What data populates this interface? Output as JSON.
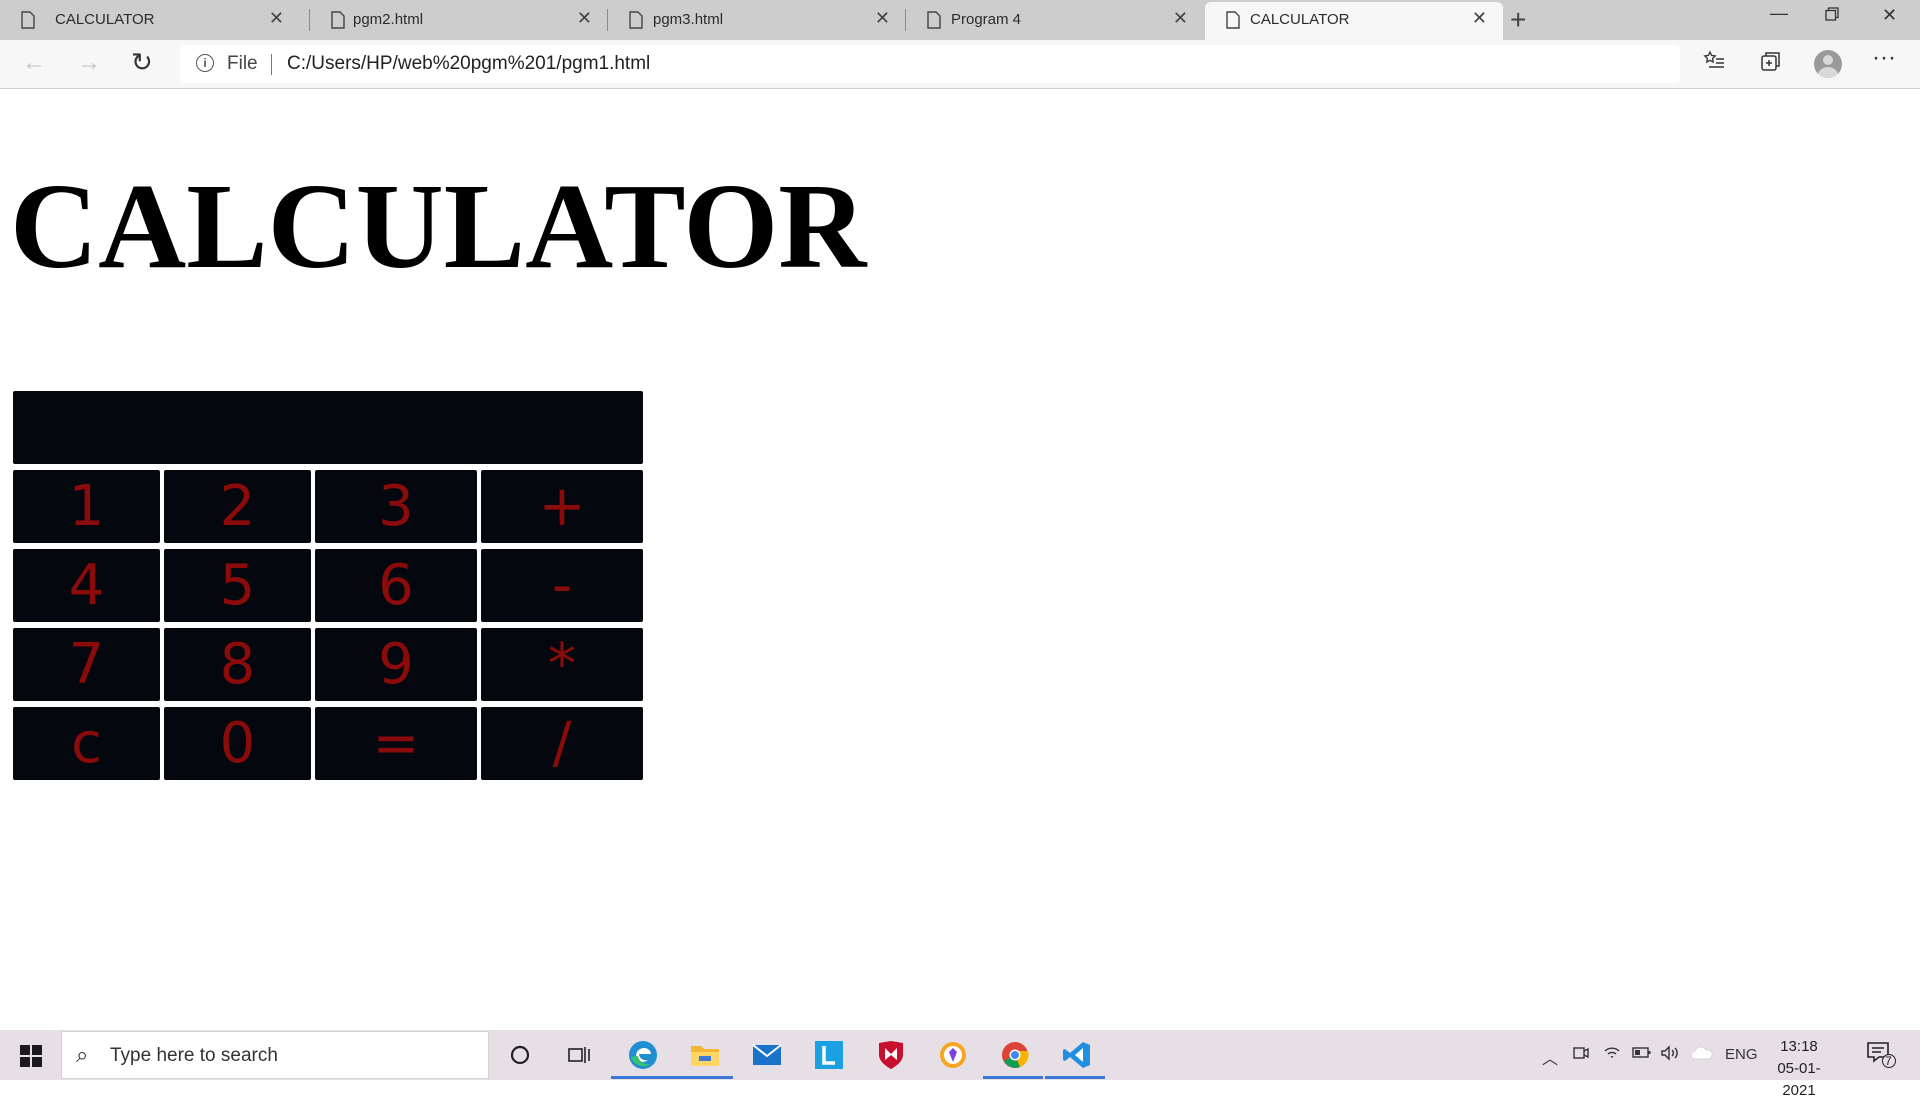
{
  "browser": {
    "tabs": [
      {
        "title": "CALCULATOR",
        "active": false
      },
      {
        "title": "pgm2.html",
        "active": false
      },
      {
        "title": "pgm3.html",
        "active": false
      },
      {
        "title": "Program 4",
        "active": false
      },
      {
        "title": "CALCULATOR",
        "active": true
      }
    ],
    "new_tab_label": "+",
    "scheme": "File",
    "url": "C:/Users/HP/web%20pgm%201/pgm1.html"
  },
  "page": {
    "title": "CALCULATOR",
    "display_value": "",
    "keys": [
      "1",
      "2",
      "3",
      "+",
      "4",
      "5",
      "6",
      "-",
      "7",
      "8",
      "9",
      "*",
      "c",
      "0",
      "=",
      "/"
    ],
    "key_color": "#8b0a0a",
    "key_background": "#05070f"
  },
  "taskbar": {
    "search_placeholder": "Type here to search",
    "language": "ENG",
    "time": "13:18",
    "date": "05-01-2021",
    "notification_count": "7"
  }
}
